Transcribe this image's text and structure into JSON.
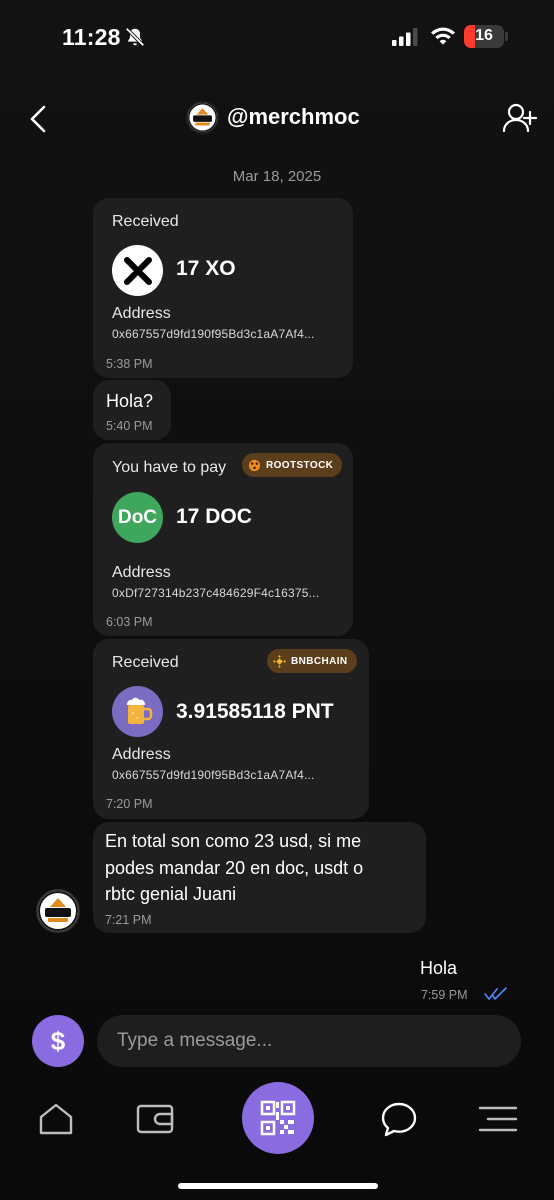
{
  "status_bar": {
    "time": "11:28",
    "battery": "16"
  },
  "header": {
    "username": "@merchmoc"
  },
  "date_separator": "Mar 18, 2025",
  "messages": [
    {
      "type": "transaction",
      "label": "Received",
      "token": "XO",
      "amount": "17 XO",
      "address_label": "Address",
      "address": "0x667557d9fd190f95Bd3c1aA7Af4...",
      "time": "5:38 PM"
    },
    {
      "type": "text",
      "text": "Hola?",
      "time": "5:40 PM"
    },
    {
      "type": "payment_request",
      "label": "You have to pay",
      "network": "ROOTSTOCK",
      "token": "DoC",
      "amount": "17 DOC",
      "address_label": "Address",
      "address": "0xDf727314b237c484629F4c16375...",
      "time": "6:03 PM"
    },
    {
      "type": "transaction",
      "label": "Received",
      "network": "BNBCHAIN",
      "token": "PNT",
      "amount": "3.91585118 PNT",
      "address_label": "Address",
      "address": "0x667557d9fd190f95Bd3c1aA7Af4...",
      "time": "7:20 PM"
    },
    {
      "type": "text",
      "lines": [
        "En total son como 23 usd, si me",
        "podes mandar 20 en doc, usdt o",
        "rbtc genial Juani"
      ],
      "time": "7:21 PM"
    },
    {
      "type": "outgoing",
      "text": "Hola",
      "time": "7:59 PM"
    }
  ],
  "composer": {
    "placeholder": "Type a message...",
    "currency_symbol": "$"
  },
  "colors": {
    "accent": "#8a6be0",
    "bubble": "#1f1f1f",
    "chip": "#5b3f1d",
    "doc_green": "#3ea75d",
    "battery_red": "#ff3b30",
    "read_ticks": "#4a8cff"
  },
  "nav": [
    "home-icon",
    "wallet-icon",
    "qr-scan-icon",
    "chat-icon",
    "menu-icon"
  ]
}
